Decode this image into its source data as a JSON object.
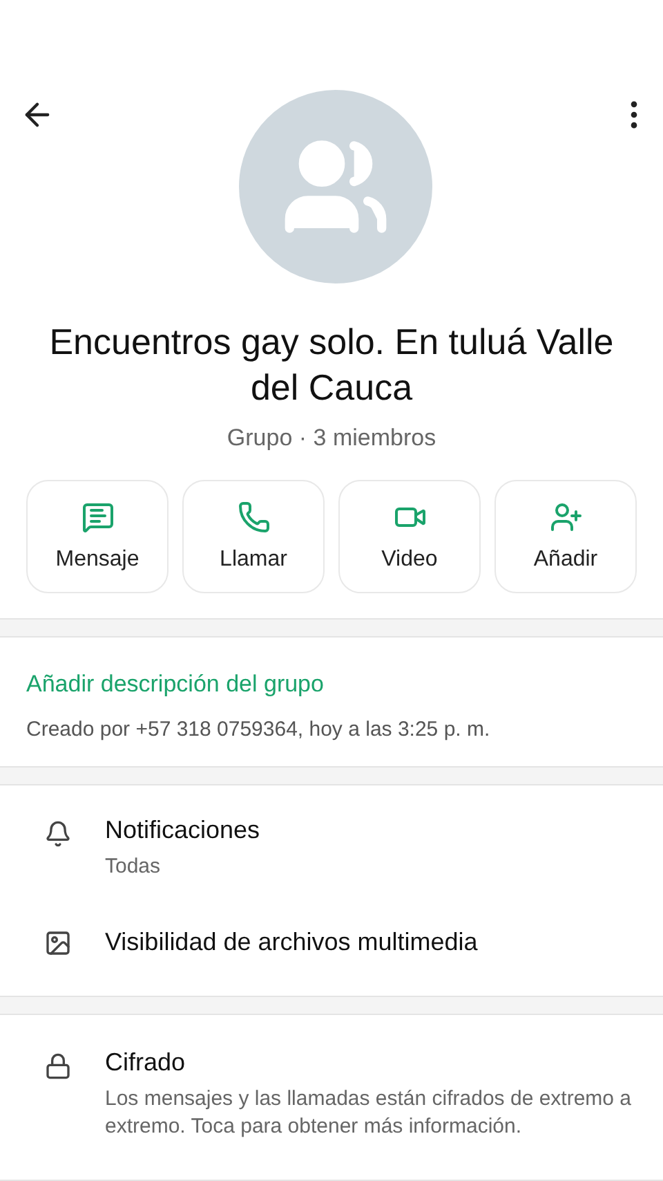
{
  "group": {
    "name": "Encuentros gay solo. En tuluá Valle del Cauca",
    "subtitle": "Grupo · 3 miembros"
  },
  "actions": [
    {
      "kind": "message",
      "label": "Mensaje"
    },
    {
      "kind": "call",
      "label": "Llamar"
    },
    {
      "kind": "video",
      "label": "Video"
    },
    {
      "kind": "add",
      "label": "Añadir"
    }
  ],
  "description": {
    "link": "Añadir descripción del grupo",
    "created": "Creado por +57 318 0759364, hoy a las 3:25 p. m."
  },
  "settings": [
    {
      "kind": "notifications",
      "title": "Notificaciones",
      "subtitle": "Todas"
    },
    {
      "kind": "media",
      "title": "Visibilidad de archivos multimedia"
    }
  ],
  "encryption": {
    "title": "Cifrado",
    "subtitle": "Los mensajes y las llamadas están cifrados de extremo a extremo. Toca para obtener más información."
  }
}
